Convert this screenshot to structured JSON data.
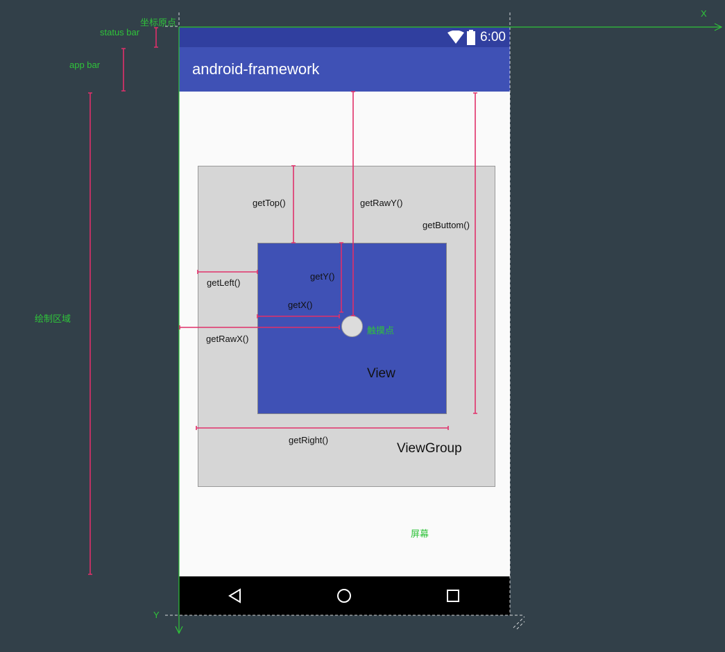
{
  "annotations": {
    "origin": "坐标原点",
    "status_bar": "status bar",
    "app_bar": "app bar",
    "draw_area": "绘制区域",
    "x_axis": "X",
    "y_axis": "Y",
    "screen": "屏幕",
    "touch_point": "触摸点"
  },
  "phone": {
    "time": "6:00",
    "app_title": "android-framework",
    "status_icons": [
      "wifi-icon",
      "battery-icon"
    ],
    "nav_icons": [
      "back-icon",
      "home-icon",
      "recents-icon"
    ]
  },
  "labels": {
    "get_top": "getTop()",
    "get_raw_y": "getRawY()",
    "get_buttom": "getButtom()",
    "get_left": "getLeft()",
    "get_y": "getY()",
    "get_x": "getX()",
    "get_raw_x": "getRawX()",
    "get_right": "getRight()",
    "view": "View",
    "view_group": "ViewGroup"
  },
  "colors": {
    "background": "#324049",
    "status_bar": "#303F9F",
    "app_bar": "#3F51B5",
    "view": "#3F51B5",
    "measure": "#e0306a",
    "annotation": "#2fc33a"
  }
}
